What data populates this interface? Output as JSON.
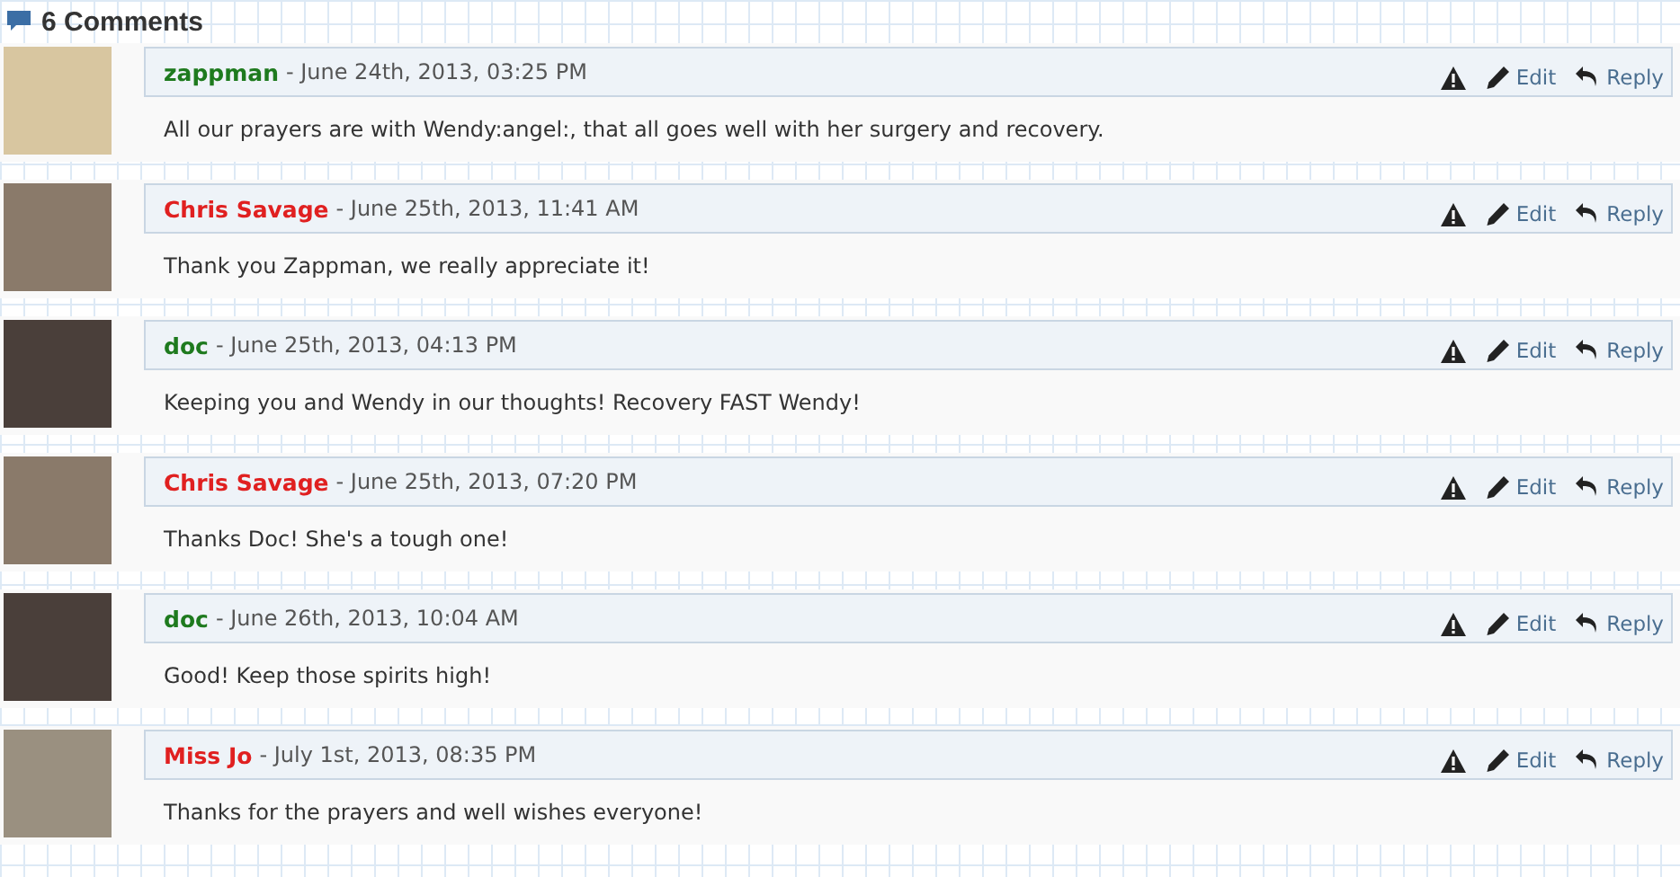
{
  "heading": "6 Comments",
  "comments": [
    {
      "author": "zappman",
      "color": "#1e7a1e",
      "date": "- June 24th, 2013, 03:25 PM",
      "text": "All our prayers are with Wendy:angel:, that all goes well with her surgery and recovery.",
      "edit": "Edit",
      "reply": "Reply"
    },
    {
      "author": "Chris Savage",
      "color": "#e02020",
      "date": "- June 25th, 2013, 11:41 AM",
      "text": "Thank you Zappman, we really appreciate it!",
      "edit": "Edit",
      "reply": "Reply"
    },
    {
      "author": "doc",
      "color": "#1e7a1e",
      "date": "- June 25th, 2013, 04:13 PM",
      "text": "Keeping you and Wendy in our thoughts! Recovery FAST Wendy!",
      "edit": "Edit",
      "reply": "Reply"
    },
    {
      "author": "Chris Savage",
      "color": "#e02020",
      "date": "- June 25th, 2013, 07:20 PM",
      "text": "Thanks Doc! She's a tough one!",
      "edit": "Edit",
      "reply": "Reply"
    },
    {
      "author": "doc",
      "color": "#1e7a1e",
      "date": "- June 26th, 2013, 10:04 AM",
      "text": "Good! Keep those spirits high!",
      "edit": "Edit",
      "reply": "Reply"
    },
    {
      "author": "Miss Jo",
      "color": "#e02020",
      "date": "- July 1st, 2013, 08:35 PM",
      "text": "Thanks for the prayers and well wishes everyone!",
      "edit": "Edit",
      "reply": "Reply"
    }
  ]
}
